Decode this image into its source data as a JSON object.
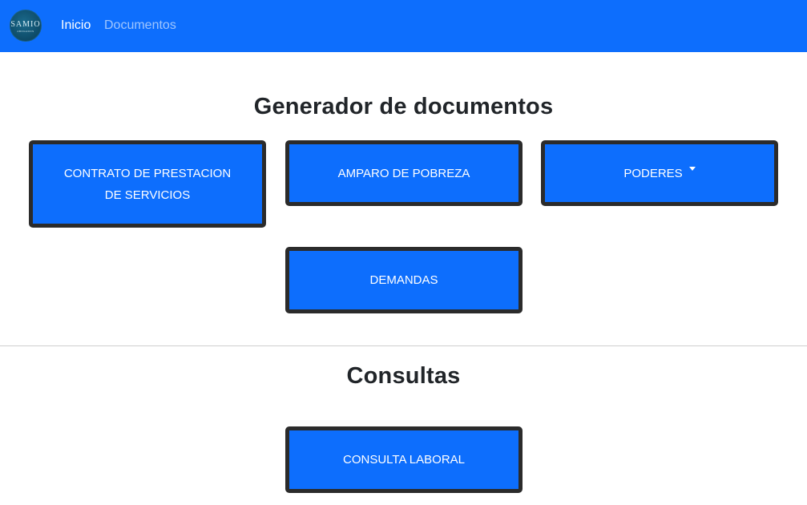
{
  "navbar": {
    "logo_text": "SAMIO",
    "logo_subtext": "ABOGADOS",
    "links": [
      {
        "label": "Inicio",
        "active": true
      },
      {
        "label": "Documentos",
        "active": false
      }
    ],
    "background_color": "#0d6efd"
  },
  "generator": {
    "title": "Generador de documentos",
    "buttons": {
      "contrato": "CONTRATO DE PRESTACION DE SERVICIOS",
      "amparo": "AMPARO DE POBREZA",
      "poderes": "PODERES",
      "demandas": "DEMANDAS"
    },
    "poderes_icon": "caret-down-icon"
  },
  "consultas": {
    "title": "Consultas",
    "buttons": {
      "laboral": "CONSULTA LABORAL"
    }
  },
  "colors": {
    "button_bg": "#0d6efd",
    "button_border": "#2b2b2b",
    "text": "#212529"
  }
}
